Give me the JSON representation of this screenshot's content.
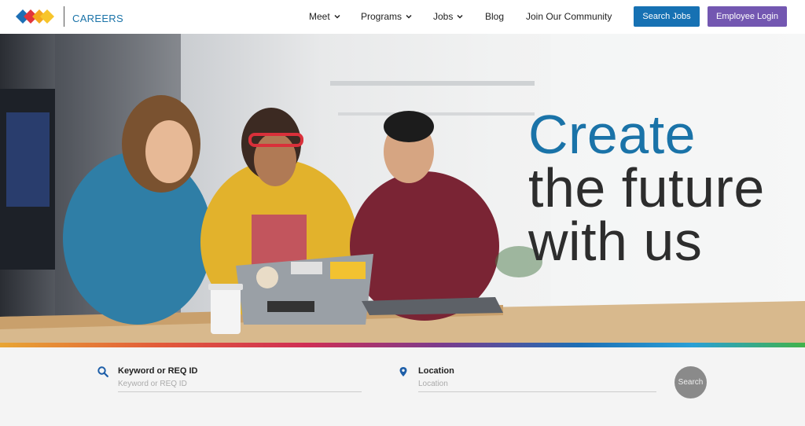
{
  "header": {
    "brand": "CAREERS",
    "nav": [
      {
        "label": "Meet",
        "has_dropdown": true
      },
      {
        "label": "Programs",
        "has_dropdown": true
      },
      {
        "label": "Jobs",
        "has_dropdown": true
      },
      {
        "label": "Blog",
        "has_dropdown": false
      },
      {
        "label": "Join Our Community",
        "has_dropdown": false
      }
    ],
    "search_jobs_label": "Search Jobs",
    "employee_login_label": "Employee Login"
  },
  "hero": {
    "headline_line1": "Create",
    "headline_line2": "the future",
    "headline_line3": "with us"
  },
  "search": {
    "keyword_label": "Keyword or REQ ID",
    "keyword_placeholder": "Keyword or REQ ID",
    "location_label": "Location",
    "location_placeholder": "Location",
    "submit_label": "Search"
  },
  "icons": {
    "logo": "logo-icon",
    "keyword": "search-icon",
    "location": "map-pin-icon"
  },
  "colors": {
    "brand_blue": "#1a73a8",
    "search_button": "#1671b3",
    "login_button": "#7357b1",
    "headline_dark": "#2d2d2d"
  }
}
